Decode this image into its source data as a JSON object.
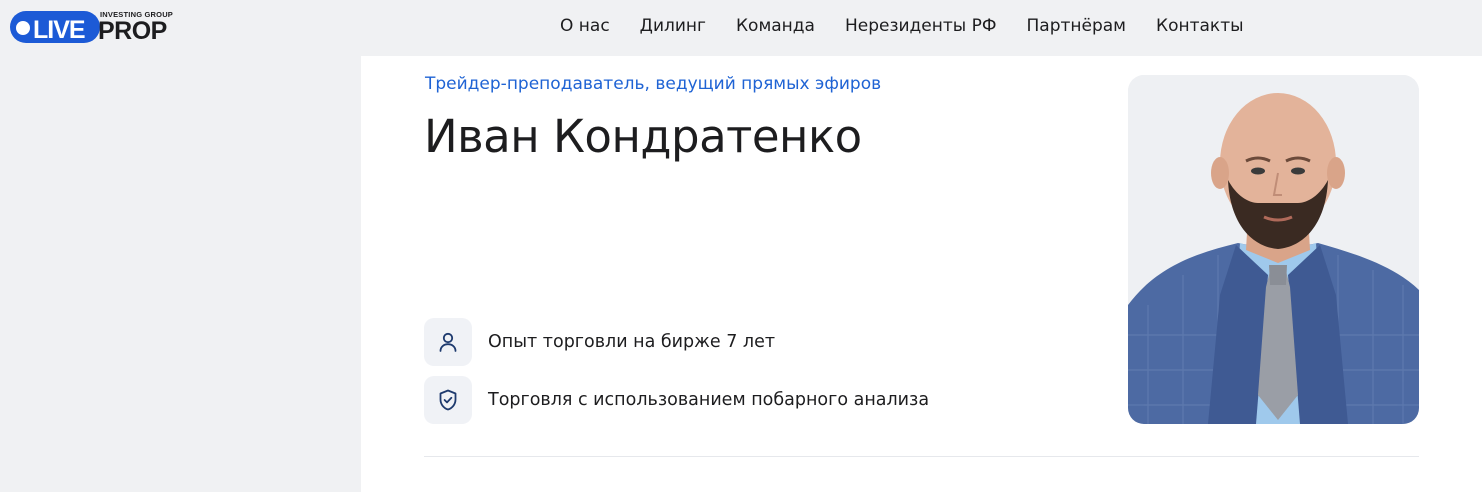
{
  "logo": {
    "live": "LIVE",
    "group": "INVESTING GROUP",
    "prop": "PROP"
  },
  "nav": {
    "items": [
      {
        "label": "О нас"
      },
      {
        "label": "Дилинг"
      },
      {
        "label": "Команда"
      },
      {
        "label": "Нерезиденты РФ"
      },
      {
        "label": "Партнёрам"
      },
      {
        "label": "Контакты"
      }
    ]
  },
  "profile": {
    "role": "Трейдер-преподаватель, ведущий прямых эфиров",
    "name": "Иван Кондратенко",
    "features": [
      {
        "icon": "user-icon",
        "text": "Опыт торговли на бирже 7 лет"
      },
      {
        "icon": "shield-check-icon",
        "text": "Торговля с использованием побарного анализа"
      }
    ]
  },
  "colors": {
    "brand": "#1c5ad6",
    "accent_text": "#1f63d4",
    "panel_bg": "#f0f1f3"
  }
}
